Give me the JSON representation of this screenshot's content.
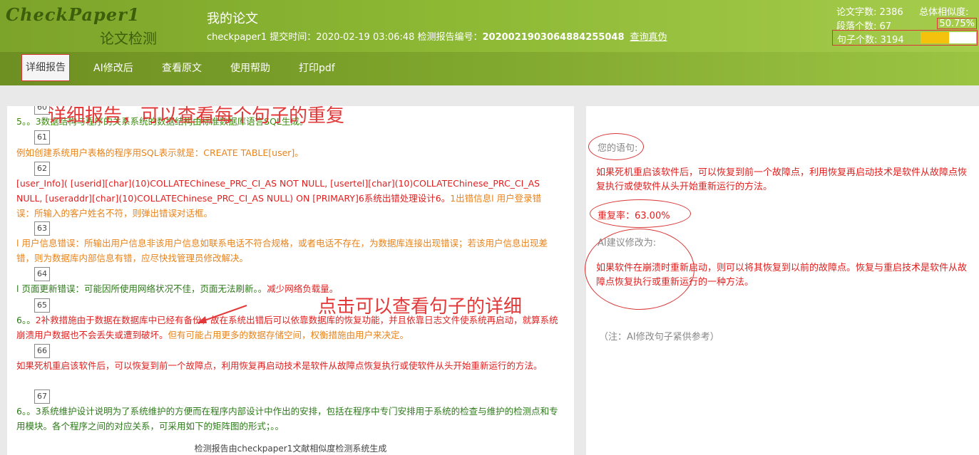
{
  "header": {
    "logo": "CheckPaper1",
    "logo_sub": "论文检测",
    "title": "我的论文",
    "meta_prefix": "checkpaper1 提交时间：2020-02-19 03:06:48 检测报告编号：",
    "report_no": "20200219030648842550​48",
    "verify_link": "查询真伪",
    "word_count": "论文字数: 2386",
    "overall_label": "总体相似度:",
    "para_count": "段落个数: 67",
    "overall_pct": "50.75%",
    "sentence_count": "句子个数: 3194",
    "progress": 0.5075
  },
  "nav": [
    "详细报告",
    "AI修改后",
    "查看原文",
    "使用帮助",
    "打印pdf"
  ],
  "annotations": {
    "top": "详细报告，可以查看每个句子的重复",
    "click": "点击可以查看句子的详细"
  },
  "left": {
    "n60": "60",
    "p60": "5。。3数据结构与程序的关系系统的数据结构由标准数据库语言SQL生成。",
    "n61": "61",
    "p61": "例如创建系统用户表格的程序用SQL表示就是：CREATE TABLE[user]。",
    "n62": "62",
    "p62_red": "[user_Info]( [userid][char](10)COLLATEChinese_PRC_CI_AS NOT NULL, [usertel][char](10)COLLATEChinese_PRC_CI_AS NULL, [useraddr][char](10)COLLATEChinese_PRC_CI_AS NULL) ON [PRIMARY]6系统出错处理设计6。",
    "p62_orange": "1出错信息l 用户登录错误：所输入的客户姓名不符，则弹出错误对话框。",
    "n63": "63",
    "p63": "l 用户信息错误：所输出用户信息非该用户信息如联系电话不符合规格，或者电话不存在，为数据库连接出现错误；若该用户信息出现差错，则为数据库内部信息有错，应尽快找管理员修改解决。",
    "n64": "64",
    "p64_green": "l 页面更新错误：可能因所使用网络状况不佳，页面无法刷新。。",
    "p64_red": "减少网络负载量。",
    "n65": "65",
    "p65_green": "6。。",
    "p65_red": "2补救措施由于数据在数据库中已经有备份，故在系统出错后可以依靠数据库的恢复功能，并且依靠日志文件使系统再启动，就算系统崩溃用户数据也不会丢失或遭到破坏。",
    "p65_orange": "但有可能占用更多的数据存储空间，权衡措施由用户来决定。",
    "n66": "66",
    "p66": "如果死机重启该软件后，可以恢复到前一个故障点，利用恢复再启动技术是软件从故障点恢复执行或使软件从头开始重新运行的方法。",
    "n67": "67",
    "p67": "6。。3系统维护设计说明为了系统维护的方便而在程序内部设计中作出的安排，包括在程序中专门安排用于系统的检查与维护的检测点和专用模块。各个程序之间的对应关系，可采用如下的矩阵图的形式；。。",
    "footer": "检测报告由checkpaper1文献相似度检测系统生成"
  },
  "right": {
    "your_sentence_label": "您的语句:",
    "your_sentence": "如果死机重启该软件后，可以恢复到前一个故障点，利用恢复再启动技术是软件从故障点恢复执行或使软件从头开始重新运行的方法。",
    "repeat_rate": "重复率：63.00%",
    "ai_label": "AI建议修改为:",
    "ai_text": "如果软件在崩溃时重新启动，则可以将其恢复到以前的故障点。恢复与重启技术是软件从故障点恢复执行或重新运行的一种方法。",
    "note": "（注：AI修改句子紧供参考）"
  }
}
